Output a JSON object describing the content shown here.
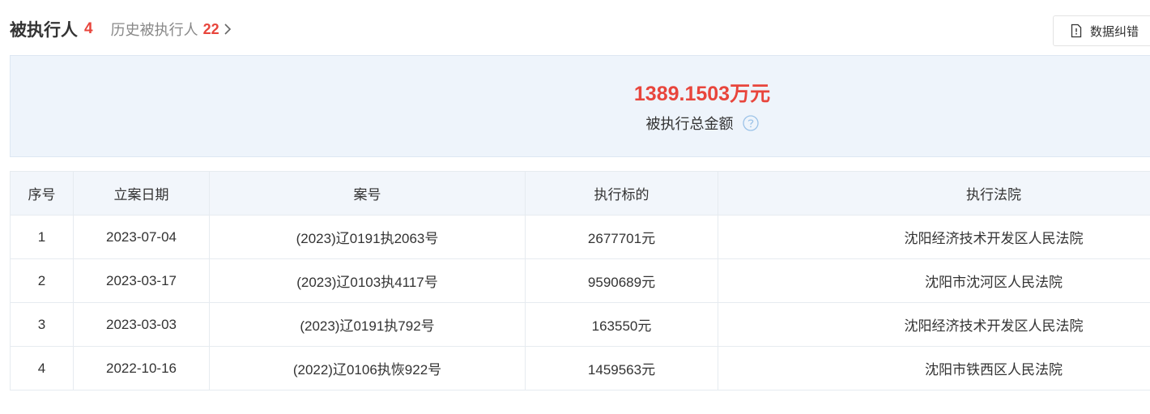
{
  "header": {
    "title": "被执行人",
    "title_count": "4",
    "history_label": "历史被执行人",
    "history_count": "22",
    "correct_button_label": "数据纠错"
  },
  "summary": {
    "amount": "1389.1503万元",
    "caption": "被执行总金额"
  },
  "table": {
    "headers": {
      "index": "序号",
      "filing_date": "立案日期",
      "case_no": "案号",
      "target": "执行标的",
      "court": "执行法院"
    },
    "rows": [
      {
        "index": "1",
        "filing_date": "2023-07-04",
        "case_no": "(2023)辽0191执2063号",
        "target": "2677701元",
        "court": "沈阳经济技术开发区人民法院"
      },
      {
        "index": "2",
        "filing_date": "2023-03-17",
        "case_no": "(2023)辽0103执4117号",
        "target": "9590689元",
        "court": "沈阳市沈河区人民法院"
      },
      {
        "index": "3",
        "filing_date": "2023-03-03",
        "case_no": "(2023)辽0191执792号",
        "target": "163550元",
        "court": "沈阳经济技术开发区人民法院"
      },
      {
        "index": "4",
        "filing_date": "2022-10-16",
        "case_no": "(2022)辽0106执恢922号",
        "target": "1459563元",
        "court": "沈阳市铁西区人民法院"
      }
    ]
  },
  "colors": {
    "accent_red": "#e8453c",
    "panel_bg": "#eef4fb",
    "table_header_bg": "#f2f6fb",
    "help_icon": "#9cc3e8"
  },
  "icons": {
    "history_chevron": "chevron-right-icon",
    "correct_button": "document-icon",
    "summary_help": "help-icon"
  }
}
